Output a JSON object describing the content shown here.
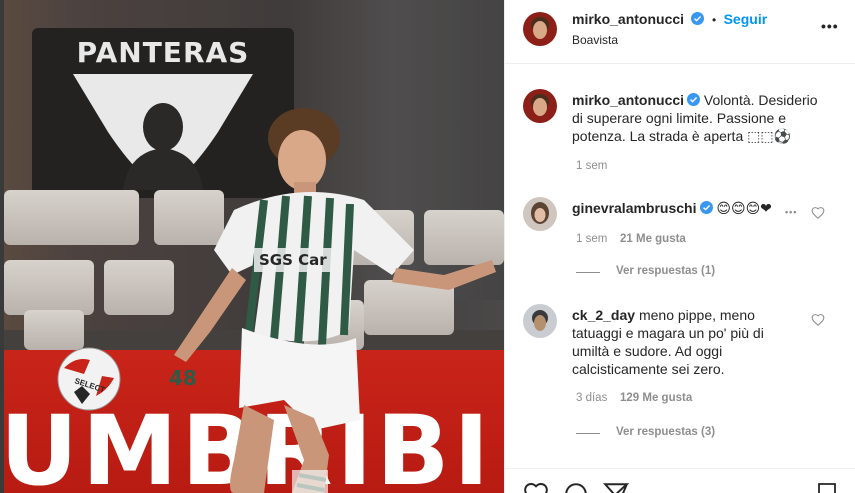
{
  "photo": {
    "banner_text": "PANTERAS",
    "board_text": "UMBRIBI",
    "shirt_sponsor": "SGS Car",
    "shirt_number": "48",
    "ball_text": "SELECT"
  },
  "post": {
    "author": "mirko_antonucci",
    "location": "Boavista",
    "follow_label": "Seguir",
    "bullet": "•",
    "caption_lines": [
      "Volontà. Desiderio",
      "di superare ogni limite. Passione e",
      "potenza. La strada è aperta ⬚⬚⚽"
    ],
    "caption_time": "1 sem"
  },
  "comments": [
    {
      "username": "ginevralambruschi",
      "verified": true,
      "text": "😊😊😊❤",
      "time": "1 sem",
      "likes": "21 Me gusta",
      "replies": "Ver respuestas (1)"
    },
    {
      "username": "ck_2_day",
      "verified": false,
      "lines": [
        "meno pippe, meno",
        "tatuaggi e magara un po' più di",
        "umiltà e sudore. Ad oggi",
        "calcisticamente sei zero."
      ],
      "time": "3 días",
      "likes": "129 Me gusta",
      "replies": "Ver respuestas (3)"
    }
  ],
  "colors": {
    "link_blue": "#0095f6",
    "verified_blue": "#3897f0",
    "muted": "#8e8e8e",
    "banner_red": "#c92419"
  }
}
